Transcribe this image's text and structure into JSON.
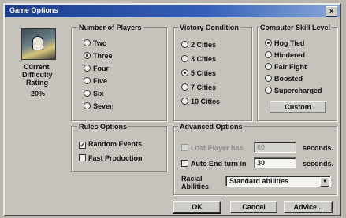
{
  "window": {
    "title": "Game Options",
    "close_glyph": "×"
  },
  "difficulty": {
    "label_line1": "Current",
    "label_line2": "Difficulty",
    "label_line3": "Rating",
    "value": "20%"
  },
  "players": {
    "label": "Number of Players",
    "options": [
      "Two",
      "Three",
      "Four",
      "Five",
      "Six",
      "Seven"
    ],
    "selected": "Three"
  },
  "victory": {
    "label": "Victory Condition",
    "options": [
      "2 Cities",
      "3 Cities",
      "5 Cities",
      "7 Cities",
      "10 Cities"
    ],
    "selected": "5 Cities"
  },
  "skill": {
    "label": "Computer Skill Level",
    "options": [
      "Hog Tied",
      "Hindered",
      "Fair Fight",
      "Boosted",
      "Supercharged"
    ],
    "selected": "Hog Tied",
    "custom_label": "Custom"
  },
  "rules": {
    "label": "Rules Options",
    "random_events": "Random Events",
    "random_events_checked": true,
    "fast_production": "Fast Production",
    "fast_production_checked": false
  },
  "advanced": {
    "label": "Advanced Options",
    "lost_player_label": "Lost Player has",
    "lost_player_value": "60",
    "seconds1": "seconds.",
    "auto_end_label": "Auto End turn in",
    "auto_end_value": "30",
    "seconds2": "seconds.",
    "racial_line1": "Racial",
    "racial_line2": "Abilities",
    "racial_value": "Standard abilities"
  },
  "buttons": {
    "ok": "OK",
    "cancel": "Cancel",
    "advice": "Advice..."
  }
}
